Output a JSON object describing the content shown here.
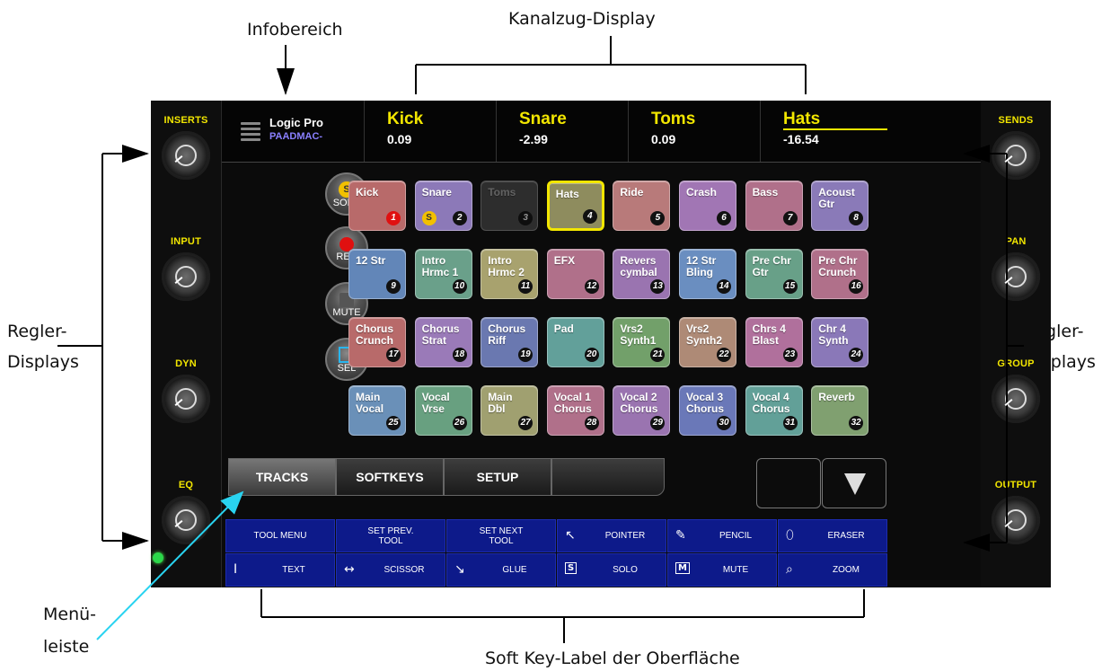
{
  "callouts": {
    "infobereich": "Infobereich",
    "kanalzug": "Kanalzug-Display",
    "regler_left": "Regler-\nDisplays",
    "regler_right": "Regler-\nDisplays",
    "menu": "Menü-\nleiste",
    "softkey": "Soft Key-Label der Oberfläche"
  },
  "info": {
    "app": "Logic Pro",
    "host": "PAADMAC-"
  },
  "channels": [
    {
      "name": "Kick",
      "value": "0.09"
    },
    {
      "name": "Snare",
      "value": "-2.99"
    },
    {
      "name": "Toms",
      "value": "0.09"
    },
    {
      "name": "Hats",
      "value": "-16.54"
    }
  ],
  "knobs_left": [
    "INSERTS",
    "INPUT",
    "DYN",
    "EQ"
  ],
  "knobs_right": [
    "SENDS",
    "PAN",
    "GROUP",
    "OUTPUT"
  ],
  "modes": {
    "solo": "SOLO",
    "rec": "REC",
    "mute": "MUTE",
    "sel": "SEL",
    "solo_symbol": "S"
  },
  "tracks": [
    {
      "name": "Kick",
      "num": "1",
      "color": "#b86a6a",
      "rec": true
    },
    {
      "name": "Snare",
      "num": "2",
      "color": "#8c79b8",
      "solo": true
    },
    {
      "name": "Toms",
      "num": "3",
      "color": "#4a4a4a",
      "dim": true
    },
    {
      "name": "Hats",
      "num": "4",
      "color": "#8e8c5e",
      "selected": true
    },
    {
      "name": "Ride",
      "num": "5",
      "color": "#b87a7a"
    },
    {
      "name": "Crash",
      "num": "6",
      "color": "#a176b4"
    },
    {
      "name": "Bass",
      "num": "7",
      "color": "#b0708a"
    },
    {
      "name": "Acoust\nGtr",
      "num": "8",
      "color": "#8a7ab8"
    },
    {
      "name": "12 Str",
      "num": "9",
      "color": "#6286b8"
    },
    {
      "name": "Intro\nHrmc 1",
      "num": "10",
      "color": "#6aa08a"
    },
    {
      "name": "Intro\nHrmc 2",
      "num": "11",
      "color": "#a8a26e"
    },
    {
      "name": "EFX",
      "num": "12",
      "color": "#b0708a"
    },
    {
      "name": "Revers\ncymbal",
      "num": "13",
      "color": "#9a74b0"
    },
    {
      "name": "12 Str\nBling",
      "num": "14",
      "color": "#6a8ec0"
    },
    {
      "name": "Pre Chr\nGtr",
      "num": "15",
      "color": "#68a088"
    },
    {
      "name": "Pre Chr\nCrunch",
      "num": "16",
      "color": "#b0708a"
    },
    {
      "name": "Chorus\nCrunch",
      "num": "17",
      "color": "#b86a6a"
    },
    {
      "name": "Chorus\nStrat",
      "num": "18",
      "color": "#9a7ab8"
    },
    {
      "name": "Chorus\nRiff",
      "num": "19",
      "color": "#6a78b0"
    },
    {
      "name": "Pad",
      "num": "20",
      "color": "#62a09a"
    },
    {
      "name": "Vrs2\nSynth1",
      "num": "21",
      "color": "#72a06a"
    },
    {
      "name": "Vrs2\nSynth2",
      "num": "22",
      "color": "#ae8a76"
    },
    {
      "name": "Chrs 4\nBlast",
      "num": "23",
      "color": "#b0709c"
    },
    {
      "name": "Chr 4\nSynth",
      "num": "24",
      "color": "#8a78b8"
    },
    {
      "name": "Main\nVocal",
      "num": "25",
      "color": "#6a90b8"
    },
    {
      "name": "Vocal\nVrse",
      "num": "26",
      "color": "#68a080"
    },
    {
      "name": "Main\nDbl",
      "num": "27",
      "color": "#a0a070"
    },
    {
      "name": "Vocal 1\nChorus",
      "num": "28",
      "color": "#b0708a"
    },
    {
      "name": "Vocal 2\nChorus",
      "num": "29",
      "color": "#9a74b0"
    },
    {
      "name": "Vocal 3\nChorus",
      "num": "30",
      "color": "#6a78b8"
    },
    {
      "name": "Vocal 4\nChorus",
      "num": "31",
      "color": "#62a098"
    },
    {
      "name": "Reverb",
      "num": "32",
      "color": "#80a070"
    }
  ],
  "tabs": [
    "TRACKS",
    "SOFTKEYS",
    "SETUP",
    ""
  ],
  "softkeys": [
    {
      "label": "TOOL MENU",
      "icon": ""
    },
    {
      "label": "SET PREV.\nTOOL",
      "icon": ""
    },
    {
      "label": "SET NEXT\nTOOL",
      "icon": ""
    },
    {
      "label": "POINTER",
      "icon": "pointer-icon"
    },
    {
      "label": "PENCIL",
      "icon": "pencil-icon"
    },
    {
      "label": "ERASER",
      "icon": "eraser-icon"
    },
    {
      "label": "TEXT",
      "icon": "text-cursor-icon"
    },
    {
      "label": "SCISSOR",
      "icon": "scissor-icon"
    },
    {
      "label": "GLUE",
      "icon": "glue-icon"
    },
    {
      "label": "SOLO",
      "icon": "solo-tool-icon"
    },
    {
      "label": "MUTE",
      "icon": "mute-tool-icon"
    },
    {
      "label": "ZOOM",
      "icon": "zoom-icon"
    }
  ],
  "colors": {
    "accent": "#f2e600",
    "softkey_bg": "#0d1a8a",
    "host": "#8a80ff",
    "menu_arrow": "#29d3f0"
  }
}
